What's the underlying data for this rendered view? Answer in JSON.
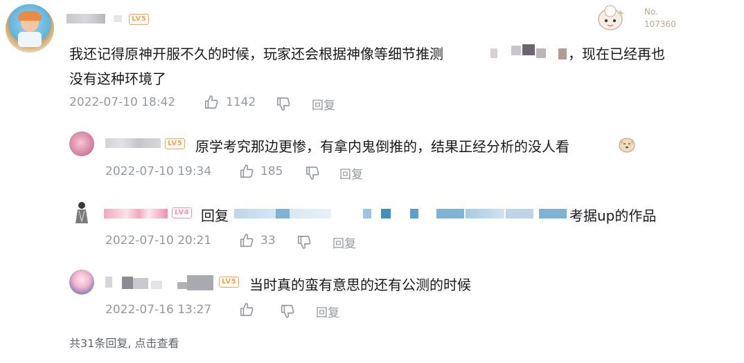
{
  "badge": {
    "no_label": "No.",
    "no_value": "107360"
  },
  "main_comment": {
    "level": "LV5",
    "text_line1_a": "我还记得原神开服不久的时候，玩家还会根据神像等细节推测",
    "text_line1_b": "，现在已经再也",
    "text_line2": "没有这种环境了",
    "time": "2022-07-10 18:42",
    "likes": "1142",
    "reply_label": "回复"
  },
  "replies": [
    {
      "level": "LV5",
      "text": "原学考究那边更惨，有拿内鬼倒推的，结果正经分析的没人看",
      "time": "2022-07-10 19:34",
      "likes": "185",
      "reply_label": "回复"
    },
    {
      "level": "LV4",
      "reply_prefix": "回复",
      "text": "考据up的作品",
      "time": "2022-07-10 20:21",
      "likes": "33",
      "reply_label": "回复"
    },
    {
      "level": "LV5",
      "text": "当时真的蛮有意思的还有公测的时候",
      "time": "2022-07-16 13:27",
      "likes": "",
      "reply_label": "回复"
    }
  ],
  "footer": {
    "more_replies": "共31条回复, 点击查看"
  },
  "colors": {
    "meta": "#9499a0",
    "level_orange": "#ff9f43",
    "level_pink": "#ff8fa3"
  }
}
